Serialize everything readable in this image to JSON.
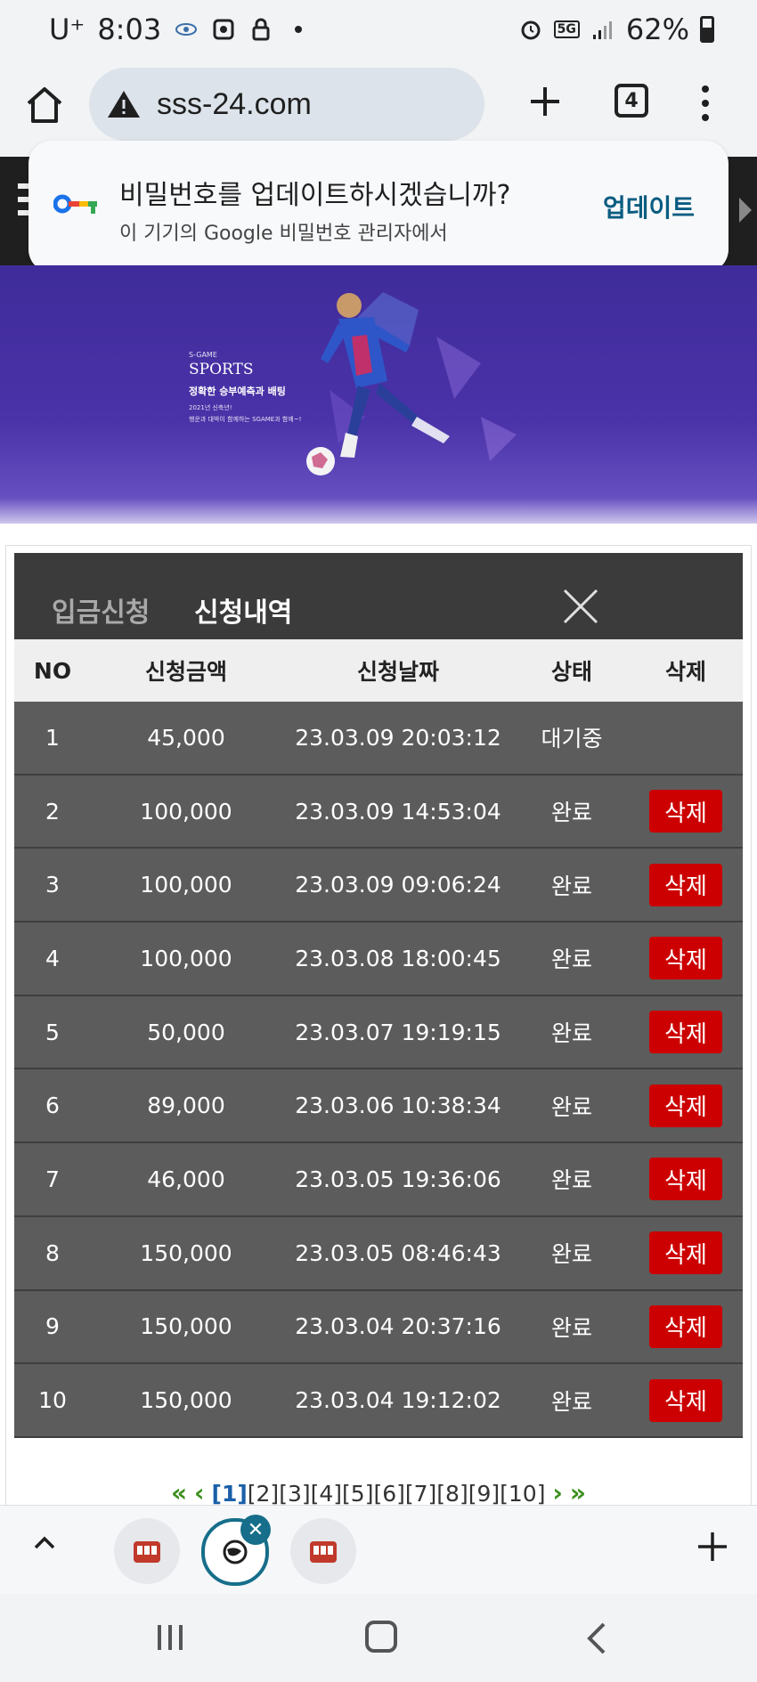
{
  "status_bar": {
    "carrier": "U⁺",
    "time": "8:03",
    "network": "5G",
    "battery": "62%"
  },
  "browser": {
    "url": "sss-24.com",
    "tab_count": "4"
  },
  "password_prompt": {
    "title": "비밀번호를 업데이트하시겠습니까?",
    "subtitle": "이 기기의 Google 비밀번호 관리자에서",
    "action": "업데이트"
  },
  "banner": {
    "brand_small": "S-GAME",
    "title": "SPORTS",
    "subtitle": "정확한 승부예측과 배팅",
    "line1": "2021년 신축년!",
    "line2": "행운과 대박이 함께하는 SGAME과 함께~!"
  },
  "modal": {
    "tabs": [
      "입금신청",
      "신청내역"
    ],
    "active_tab": 1,
    "columns": [
      "NO",
      "신청금액",
      "신청날짜",
      "상태",
      "삭제"
    ],
    "rows": [
      {
        "no": "1",
        "amount": "45,000",
        "date": "23.03.09 20:03:12",
        "status": "대기중",
        "delete": ""
      },
      {
        "no": "2",
        "amount": "100,000",
        "date": "23.03.09 14:53:04",
        "status": "완료",
        "delete": "삭제"
      },
      {
        "no": "3",
        "amount": "100,000",
        "date": "23.03.09 09:06:24",
        "status": "완료",
        "delete": "삭제"
      },
      {
        "no": "4",
        "amount": "100,000",
        "date": "23.03.08 18:00:45",
        "status": "완료",
        "delete": "삭제"
      },
      {
        "no": "5",
        "amount": "50,000",
        "date": "23.03.07 19:19:15",
        "status": "완료",
        "delete": "삭제"
      },
      {
        "no": "6",
        "amount": "89,000",
        "date": "23.03.06 10:38:34",
        "status": "완료",
        "delete": "삭제"
      },
      {
        "no": "7",
        "amount": "46,000",
        "date": "23.03.05 19:36:06",
        "status": "완료",
        "delete": "삭제"
      },
      {
        "no": "8",
        "amount": "150,000",
        "date": "23.03.05 08:46:43",
        "status": "완료",
        "delete": "삭제"
      },
      {
        "no": "9",
        "amount": "150,000",
        "date": "23.03.04 20:37:16",
        "status": "완료",
        "delete": "삭제"
      },
      {
        "no": "10",
        "amount": "150,000",
        "date": "23.03.04 19:12:02",
        "status": "완료",
        "delete": "삭제"
      }
    ]
  },
  "pagination": {
    "first": "«",
    "prev": "‹",
    "pages": [
      "[1]",
      "[2]",
      "[3]",
      "[4]",
      "[5]",
      "[6]",
      "[7]",
      "[8]",
      "[9]",
      "[10]"
    ],
    "current": "[1]",
    "next": "›",
    "last": "»"
  },
  "tab_strip": {
    "chips": [
      "slot-machine-icon",
      "globe-icon",
      "slot-machine-icon"
    ],
    "active_index": 1,
    "chip_close": "✕"
  },
  "colors": {
    "accent_update": "#0a5c80",
    "delete_button": "#cc0000",
    "row_bg": "#5c5c5c",
    "header_bg": "#3b3b3b",
    "banner_bg": "#4a32a8",
    "tab_ring": "#166e8a"
  }
}
